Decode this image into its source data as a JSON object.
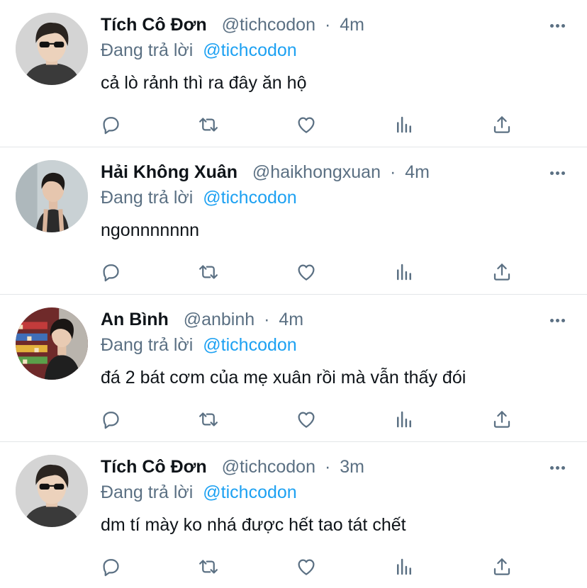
{
  "tweets": [
    {
      "name": "Tích Cô Đơn",
      "handle": "@tichcodon",
      "separator": "·",
      "time": "4m",
      "reply_prefix": "Đang trả lời",
      "reply_to": "@tichcodon",
      "text": "cả lò rảnh thì ra đây ăn hộ",
      "avatar_icon": "avatar-sunglasses"
    },
    {
      "name": "Hải Không Xuân",
      "handle": "@haikhongxuan",
      "separator": "·",
      "time": "4m",
      "reply_prefix": "Đang trả lời",
      "reply_to": "@tichcodon",
      "text": "ngonnnnnnn",
      "avatar_icon": "avatar-tanktop"
    },
    {
      "name": "An Bình",
      "handle": "@anbinh",
      "separator": "·",
      "time": "4m",
      "reply_prefix": "Đang trả lời",
      "reply_to": "@tichcodon",
      "text": "đá 2 bát cơm của mẹ xuân rồi mà vẫn thấy đói",
      "avatar_icon": "avatar-store"
    },
    {
      "name": "Tích Cô Đơn",
      "handle": "@tichcodon",
      "separator": "·",
      "time": "3m",
      "reply_prefix": "Đang trả lời",
      "reply_to": "@tichcodon",
      "text": "dm tí mày ko nhá được hết tao tát chết",
      "avatar_icon": "avatar-sunglasses"
    }
  ],
  "actions": [
    "reply-icon",
    "retweet-icon",
    "like-icon",
    "analytics-icon",
    "share-icon"
  ],
  "colors": {
    "text": "#0f1419",
    "secondary": "#5b7083",
    "accent": "#1da1f2",
    "divider": "#e3e6e8"
  }
}
